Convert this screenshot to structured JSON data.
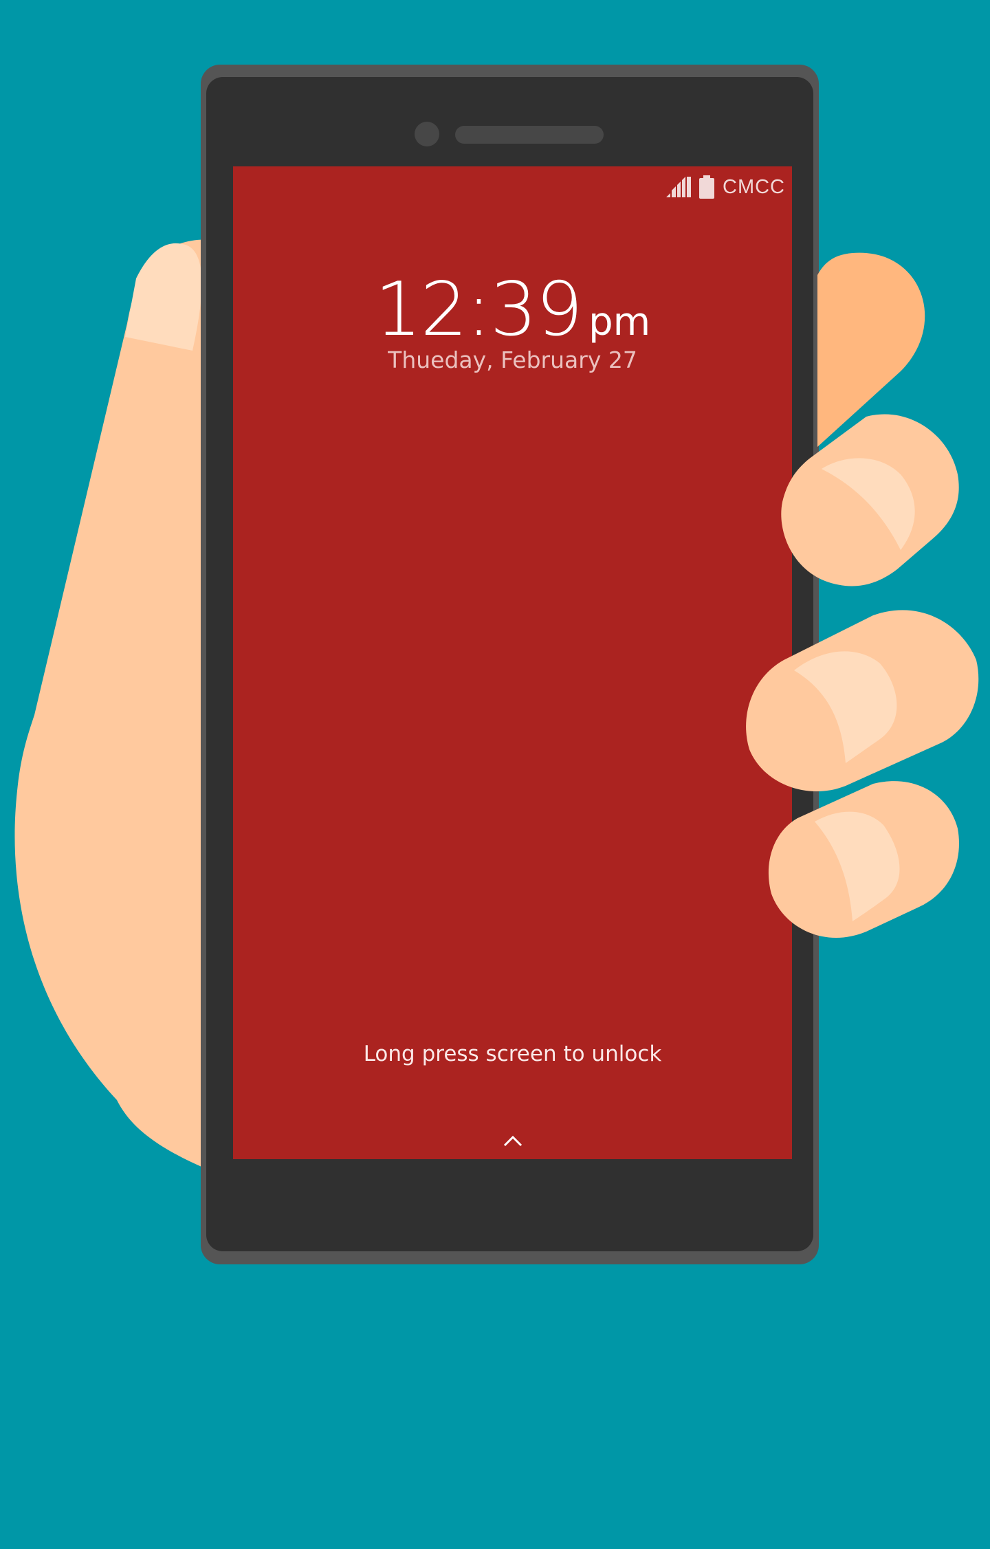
{
  "lockscreen": {
    "carrier": "CMCC",
    "time": "12:39",
    "ampm": "pm",
    "date": "Thueday, February 27",
    "unlock_hint": "Long press screen to unlock"
  },
  "icons": [
    "signal-icon",
    "battery-icon",
    "chevron-up-icon"
  ],
  "colors": {
    "background": "#0097a7",
    "screen": "#ab2320",
    "phone_body": "#303030",
    "phone_frame": "#555555",
    "skin": "#ffc99e"
  }
}
